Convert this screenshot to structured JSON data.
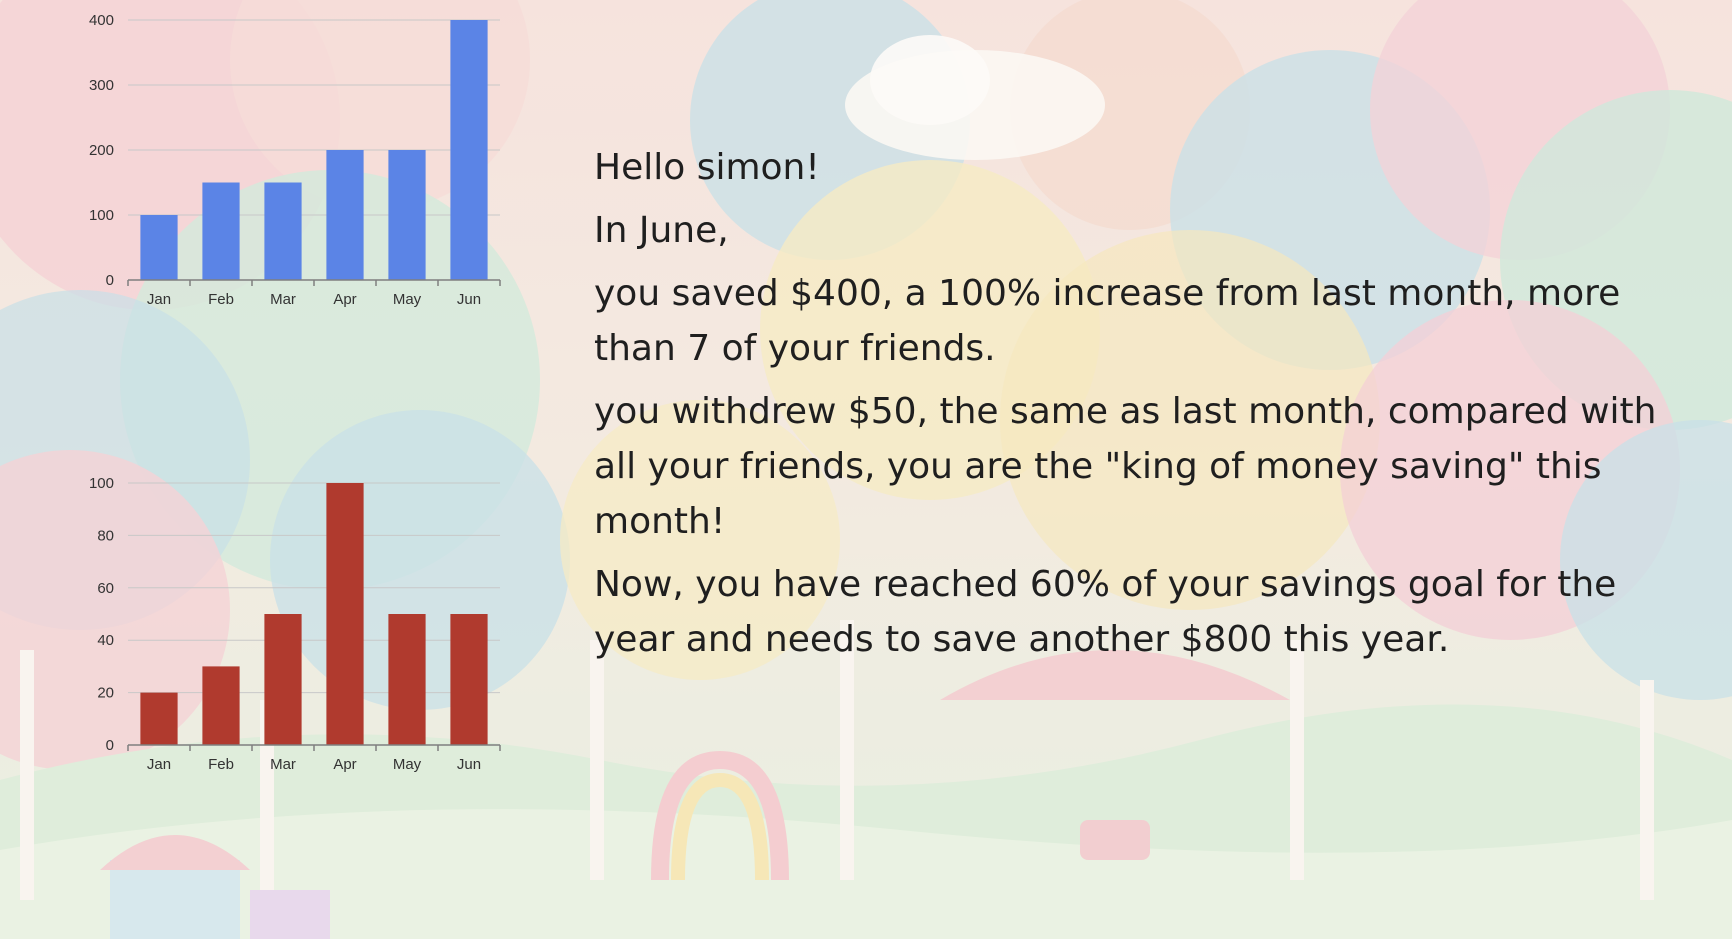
{
  "message": {
    "greeting": "Hello simon!",
    "month_line": "In June,",
    "saved_line": "you saved $400, a 100% increase from last month, more than 7 of your friends.",
    "withdrew_line": "you withdrew $50, the same as last month, compared with all your friends, you are the \"king of money saving\" this month!",
    "goal_line": "Now, you have reached 60% of your savings goal for the year and needs to save another $800 this year."
  },
  "colors": {
    "savings_bar": "#5b84e6",
    "withdraw_bar": "#b03a2e",
    "axis": "#7f7f7f",
    "grid": "#c8c8c8",
    "tick_text": "#333333"
  },
  "chart_data": [
    {
      "type": "bar",
      "categories": [
        "Jan",
        "Feb",
        "Mar",
        "Apr",
        "May",
        "Jun"
      ],
      "values": [
        100,
        150,
        150,
        200,
        200,
        400
      ],
      "yticks": [
        0,
        100,
        200,
        300,
        400
      ],
      "ylim": [
        0,
        400
      ],
      "grid": true,
      "title": "",
      "xlabel": "",
      "ylabel": ""
    },
    {
      "type": "bar",
      "categories": [
        "Jan",
        "Feb",
        "Mar",
        "Apr",
        "May",
        "Jun"
      ],
      "values": [
        20,
        30,
        50,
        100,
        50,
        50
      ],
      "yticks": [
        0,
        20,
        40,
        60,
        80,
        100
      ],
      "ylim": [
        0,
        100
      ],
      "grid": true,
      "title": "",
      "xlabel": "",
      "ylabel": ""
    }
  ]
}
